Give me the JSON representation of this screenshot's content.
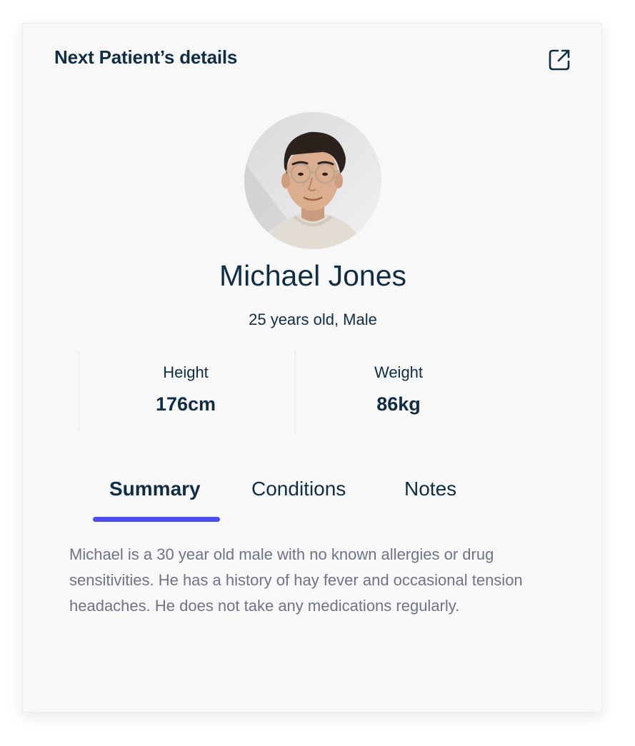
{
  "card": {
    "title": "Next Patient’s details",
    "open_icon": "external-link-icon"
  },
  "patient": {
    "name": "Michael Jones",
    "meta": "25 years old, Male",
    "avatar": "patient-avatar-photo"
  },
  "stats": [
    {
      "label": "Height",
      "value": "176cm"
    },
    {
      "label": "Weight",
      "value": "86kg"
    }
  ],
  "tabs": [
    {
      "label": "Summary",
      "active": true
    },
    {
      "label": "Conditions",
      "active": false
    },
    {
      "label": "Notes",
      "active": false
    }
  ],
  "summary_text": "Michael is a 30 year old male with no known allergies or drug sensitivities. He has a history of hay fever and occasional tension headaches. He does not take any medications regularly.",
  "colors": {
    "primary_text": "#0f2d45",
    "accent": "#4d4ef0",
    "muted_text": "#6f7387",
    "card_bg": "#f8f8f9"
  }
}
